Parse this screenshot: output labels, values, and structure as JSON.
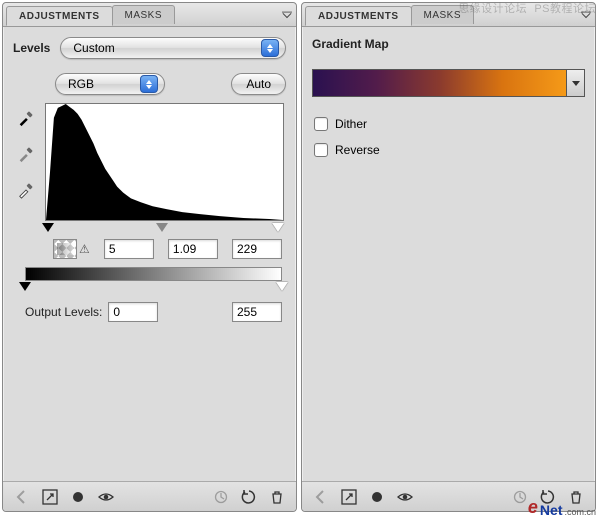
{
  "tabs": {
    "adjustments": "ADJUSTMENTS",
    "masks": "MASKS"
  },
  "left": {
    "title": "Levels",
    "preset_select": "Custom",
    "channel_select": "RGB",
    "auto_btn": "Auto",
    "input_black": "5",
    "input_mid": "1.09",
    "input_white": "229",
    "output_label": "Output Levels:",
    "output_black": "0",
    "output_white": "255"
  },
  "right": {
    "title": "Gradient Map",
    "dither": "Dither",
    "reverse": "Reverse",
    "gradient_stops": [
      "#2a1150",
      "#f59a18"
    ]
  },
  "watermarks": {
    "top_a": "思缘设计论坛",
    "top_b": "PS教程论坛",
    "bottom_e": "e",
    "bottom_net": "Net",
    "bottom_cn": ".com.cn"
  }
}
